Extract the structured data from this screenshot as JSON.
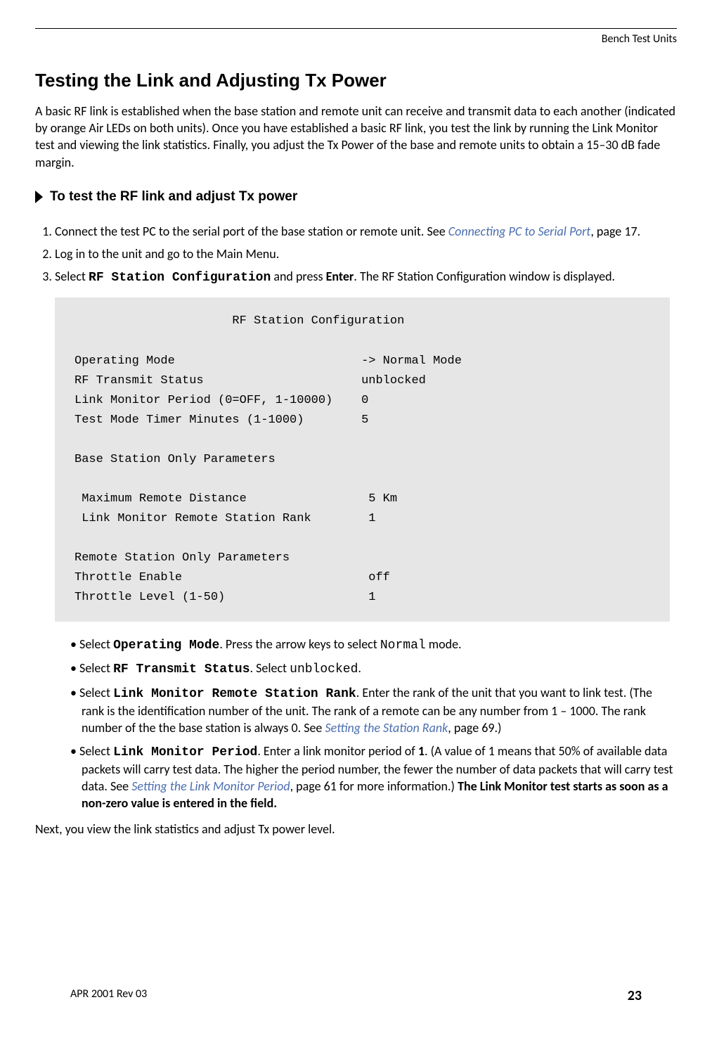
{
  "header": {
    "section_label": "Bench Test Units"
  },
  "heading": "Testing the Link and Adjusting Tx Power",
  "intro": "A basic RF link is established when the base station and remote unit can receive and transmit data to each another (indicated by orange Air LEDs on both units). Once you have established a basic RF link, you test the link by running the Link Monitor test and viewing the link statistics. Finally, you adjust the Tx Power of the base and remote units to obtain a 15–30 dB fade margin.",
  "procedure_label": "To test the RF link and adjust Tx power",
  "steps": {
    "s1_a": "Connect the test PC to the serial port of the base station or remote unit. See ",
    "s1_link": "Connecting PC to Serial Port",
    "s1_b": ", page 17.",
    "s2": "Log in to the unit and go to the Main Menu.",
    "s3_a": "Select ",
    "s3_cmd": "RF Station Configuration",
    "s3_b": " and press ",
    "s3_key": "Enter",
    "s3_c": ". The RF Station Configuration window is displayed."
  },
  "terminal": {
    "title": "RF Station Configuration",
    "rows": [
      {
        "label": "Operating Mode",
        "value": "-> Normal Mode"
      },
      {
        "label": "RF Transmit Status",
        "value": "unblocked"
      },
      {
        "label": "Link Monitor Period (0=OFF, 1-10000)",
        "value": "0"
      },
      {
        "label": "Test Mode Timer Minutes (1-1000)",
        "value": "5"
      }
    ],
    "base_hdr": "Base Station Only Parameters",
    "base_rows": [
      {
        "label": "Maximum Remote Distance",
        "value": "5 Km"
      },
      {
        "label": "Link Monitor Remote Station Rank",
        "value": "1"
      }
    ],
    "remote_hdr": "Remote Station Only Parameters",
    "remote_rows": [
      {
        "label": "Throttle Enable",
        "value": "off"
      },
      {
        "label": "Throttle Level (1-50)",
        "value": "1"
      }
    ]
  },
  "bullets": {
    "b1_a": "Select ",
    "b1_cmd": "Operating Mode",
    "b1_b": ". Press the arrow keys to select ",
    "b1_val": "Normal",
    "b1_c": " mode.",
    "b2_a": "Select ",
    "b2_cmd": "RF Transmit Status",
    "b2_b": ". Select ",
    "b2_val": "unblocked",
    "b2_c": ".",
    "b3_a": "Select ",
    "b3_cmd": "Link Monitor Remote Station Rank",
    "b3_b": ". Enter the rank of the unit that you want to link test. (The rank is the identification number of the unit. The rank of a remote can be any number from 1 – 1000. The rank number of the the base station is always 0. See ",
    "b3_link": "Setting the Station Rank",
    "b3_c": ", page 69.)",
    "b4_a": "Select ",
    "b4_cmd": "Link Monitor Period",
    "b4_b": ". Enter a link monitor period of ",
    "b4_val": "1",
    "b4_c": ". (A value of 1 means that 50% of available data packets will carry test data. The higher the period number, the fewer the number of data packets that will carry test data. See ",
    "b4_link": "Setting the Link Monitor Period",
    "b4_d": ", page 61 for more information.) ",
    "b4_bold": "The Link Monitor test starts as soon as a non-zero value is entered in the field."
  },
  "closing": "Next, you view the link statistics and adjust Tx power level.",
  "footer": {
    "left": "APR 2001 Rev 03",
    "right": "23"
  }
}
